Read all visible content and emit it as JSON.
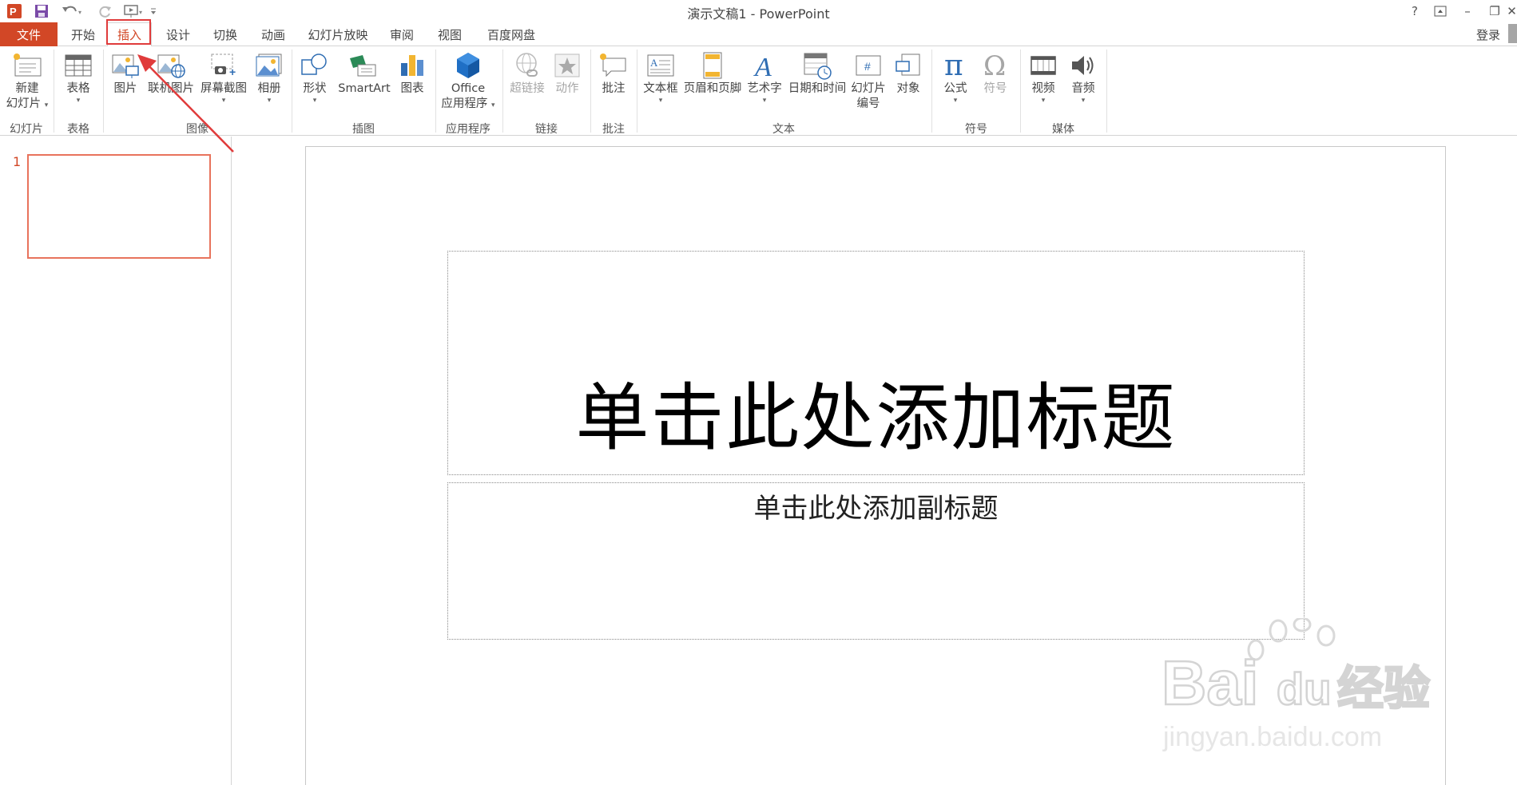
{
  "window": {
    "title": "演示文稿1 - PowerPoint",
    "help": "?",
    "minimize": "–",
    "maximize": "❐",
    "close": "✕"
  },
  "tabs": [
    {
      "id": "file",
      "label": "文件"
    },
    {
      "id": "home",
      "label": "开始"
    },
    {
      "id": "insert",
      "label": "插入",
      "active": true
    },
    {
      "id": "design",
      "label": "设计"
    },
    {
      "id": "transitions",
      "label": "切换"
    },
    {
      "id": "animations",
      "label": "动画"
    },
    {
      "id": "slideshow",
      "label": "幻灯片放映"
    },
    {
      "id": "review",
      "label": "审阅"
    },
    {
      "id": "view",
      "label": "视图"
    },
    {
      "id": "baidu",
      "label": "百度网盘"
    }
  ],
  "signin": "登录",
  "ribbon": {
    "new_slide": {
      "line1": "新建",
      "line2": "幻灯片"
    },
    "table": "表格",
    "pictures": "图片",
    "online_pictures": "联机图片",
    "screenshot": "屏幕截图",
    "photo_album": "相册",
    "shapes": "形状",
    "smartart": "SmartArt",
    "chart": "图表",
    "office_apps": {
      "line1": "Office",
      "line2": "应用程序"
    },
    "hyperlink": "超链接",
    "action": "动作",
    "comment": "批注",
    "textbox": "文本框",
    "header_footer": "页眉和页脚",
    "wordart": "艺术字",
    "date_time": "日期和时间",
    "slide_number": {
      "line1": "幻灯片",
      "line2": "编号"
    },
    "object": "对象",
    "equation": "公式",
    "symbol": "符号",
    "video": "视频",
    "audio": "音频",
    "caret": "▾",
    "groups": {
      "slides": "幻灯片",
      "tables": "表格",
      "images": "图像",
      "illustrations": "插图",
      "apps": "应用程序",
      "links": "链接",
      "comments": "批注",
      "text": "文本",
      "symbols": "符号",
      "media": "媒体"
    }
  },
  "thumbnails": [
    {
      "number": "1"
    }
  ],
  "slide": {
    "title_placeholder": "单击此处添加标题",
    "subtitle_placeholder": "单击此处添加副标题"
  },
  "watermark": {
    "brand": "Bai",
    "brand2": "du",
    "cn": "经验",
    "url": "jingyan.baidu.com"
  },
  "colors": {
    "accent": "#d24726",
    "highlight": "#e03b3b"
  }
}
